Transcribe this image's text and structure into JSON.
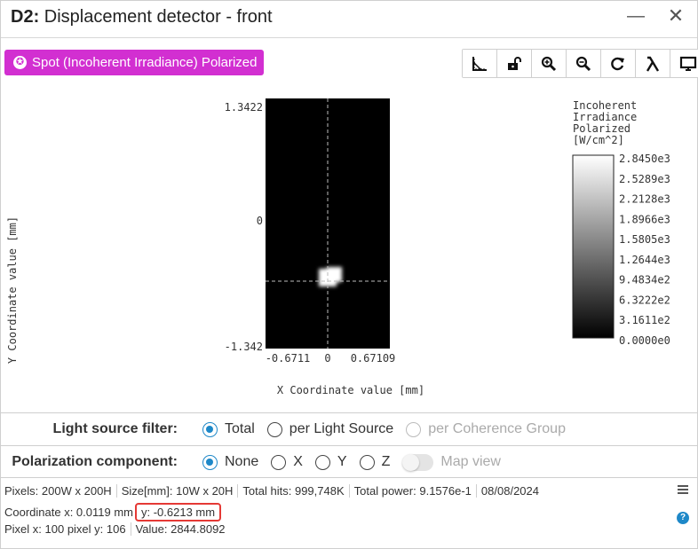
{
  "window": {
    "title_prefix": "D2:",
    "title": "Displacement detector - front",
    "minimize_glyph": "—",
    "close_glyph": "✕"
  },
  "toolbar": {
    "spot_button_label": "Spot (Incoherent Irradiance) Polarized",
    "tools": [
      "ruler-icon",
      "unlock-icon",
      "zoom-in-icon",
      "zoom-out-icon",
      "refresh-icon",
      "lambda-icon",
      "monitor-icon"
    ]
  },
  "plot": {
    "x_label": "X Coordinate value [mm]",
    "y_label": "Y Coordinate value [mm]",
    "x_ticks": [
      "-0.6711",
      "0",
      "0.67109"
    ],
    "y_ticks": [
      "1.3422",
      "0",
      "-1.342"
    ],
    "colorbar_title": [
      "Incoherent",
      "Irradiance",
      "Polarized",
      "[W/cm^2]"
    ],
    "colorbar_ticks": [
      "2.8450e3",
      "2.5289e3",
      "2.2128e3",
      "1.8966e3",
      "1.5805e3",
      "1.2644e3",
      "9.4834e2",
      "6.3222e2",
      "3.1611e2",
      "0.0000e0"
    ],
    "spot": {
      "x_mm": 0.0119,
      "y_mm": -0.6213
    }
  },
  "filters": {
    "light_source_label": "Light source filter:",
    "light_source_options": [
      {
        "label": "Total",
        "checked": true,
        "disabled": false
      },
      {
        "label": "per Light Source",
        "checked": false,
        "disabled": false
      },
      {
        "label": "per Coherence Group",
        "checked": false,
        "disabled": true
      }
    ],
    "polarization_label": "Polarization component:",
    "polarization_options": [
      {
        "label": "None",
        "checked": true
      },
      {
        "label": "X",
        "checked": false
      },
      {
        "label": "Y",
        "checked": false
      },
      {
        "label": "Z",
        "checked": false
      }
    ],
    "map_view_label": "Map view"
  },
  "status": {
    "pixels_label": "Pixels:",
    "pixels_value": "200W x 200H",
    "size_label": "Size[mm]:",
    "size_value": "10W x 20H",
    "hits_label": "Total hits:",
    "hits_value": "999,748K",
    "power_label": "Total power:",
    "power_value": "9.1576e-1",
    "date": "08/08/2024",
    "coord_x": "Coordinate x: 0.0119 mm",
    "coord_y": "y: -0.6213 mm",
    "pixel_xy": "Pixel x: 100 pixel y: 106",
    "value": "Value: 2844.8092",
    "help_glyph": "?"
  },
  "colors": {
    "accent": "#d22fd1",
    "radio_selected": "#1e88c8",
    "highlight": "#e53935"
  }
}
